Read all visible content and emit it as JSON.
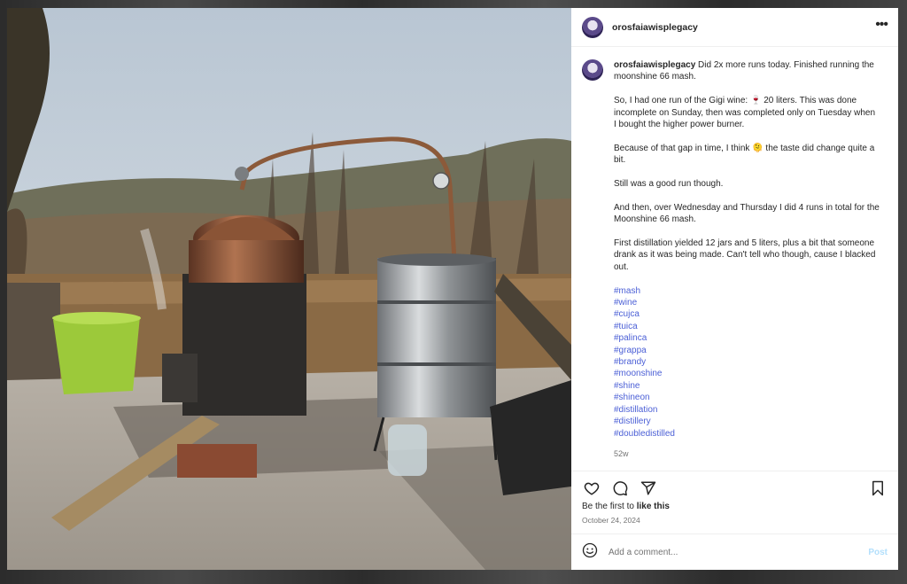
{
  "post": {
    "username": "orosfaiawisplegacy",
    "caption_paragraphs": [
      "Did 2x more runs today. Finished running the moonshine 66 mash.",
      "So, I had one run of the Gigi wine: 🍷 20 liters. This was done incomplete on Sunday, then was completed only on Tuesday when I bought the higher power burner.",
      "Because of that gap in time, I think 🫠 the taste did change quite a bit.",
      "Still was a good run though.",
      "And then, over Wednesday and Thursday I did 4 runs in total for the Moonshine 66 mash.",
      "First distillation yielded 12 jars and 5 liters, plus a bit that someone drank as it was being made. Can't tell who though, cause I blacked out."
    ],
    "hashtags": [
      "#mash",
      "#wine",
      "#cujca",
      "#tuica",
      "#palinca",
      "#grappa",
      "#brandy",
      "#moonshine",
      "#shine",
      "#shineon",
      "#distillation",
      "#distillery",
      "#doubledistilled"
    ],
    "time_ago": "52w",
    "likes_prefix": "Be the first to ",
    "likes_link": "like this",
    "date": "October 24, 2024"
  },
  "comment": {
    "placeholder": "Add a comment...",
    "post_label": "Post"
  },
  "icons": {
    "more": "more-options-icon",
    "like": "heart-icon",
    "comment": "comment-icon",
    "share": "share-icon",
    "save": "bookmark-icon",
    "emoji": "emoji-icon"
  },
  "colors": {
    "hashtag": "#4b5fd6",
    "post_button": "#b2dffc"
  }
}
